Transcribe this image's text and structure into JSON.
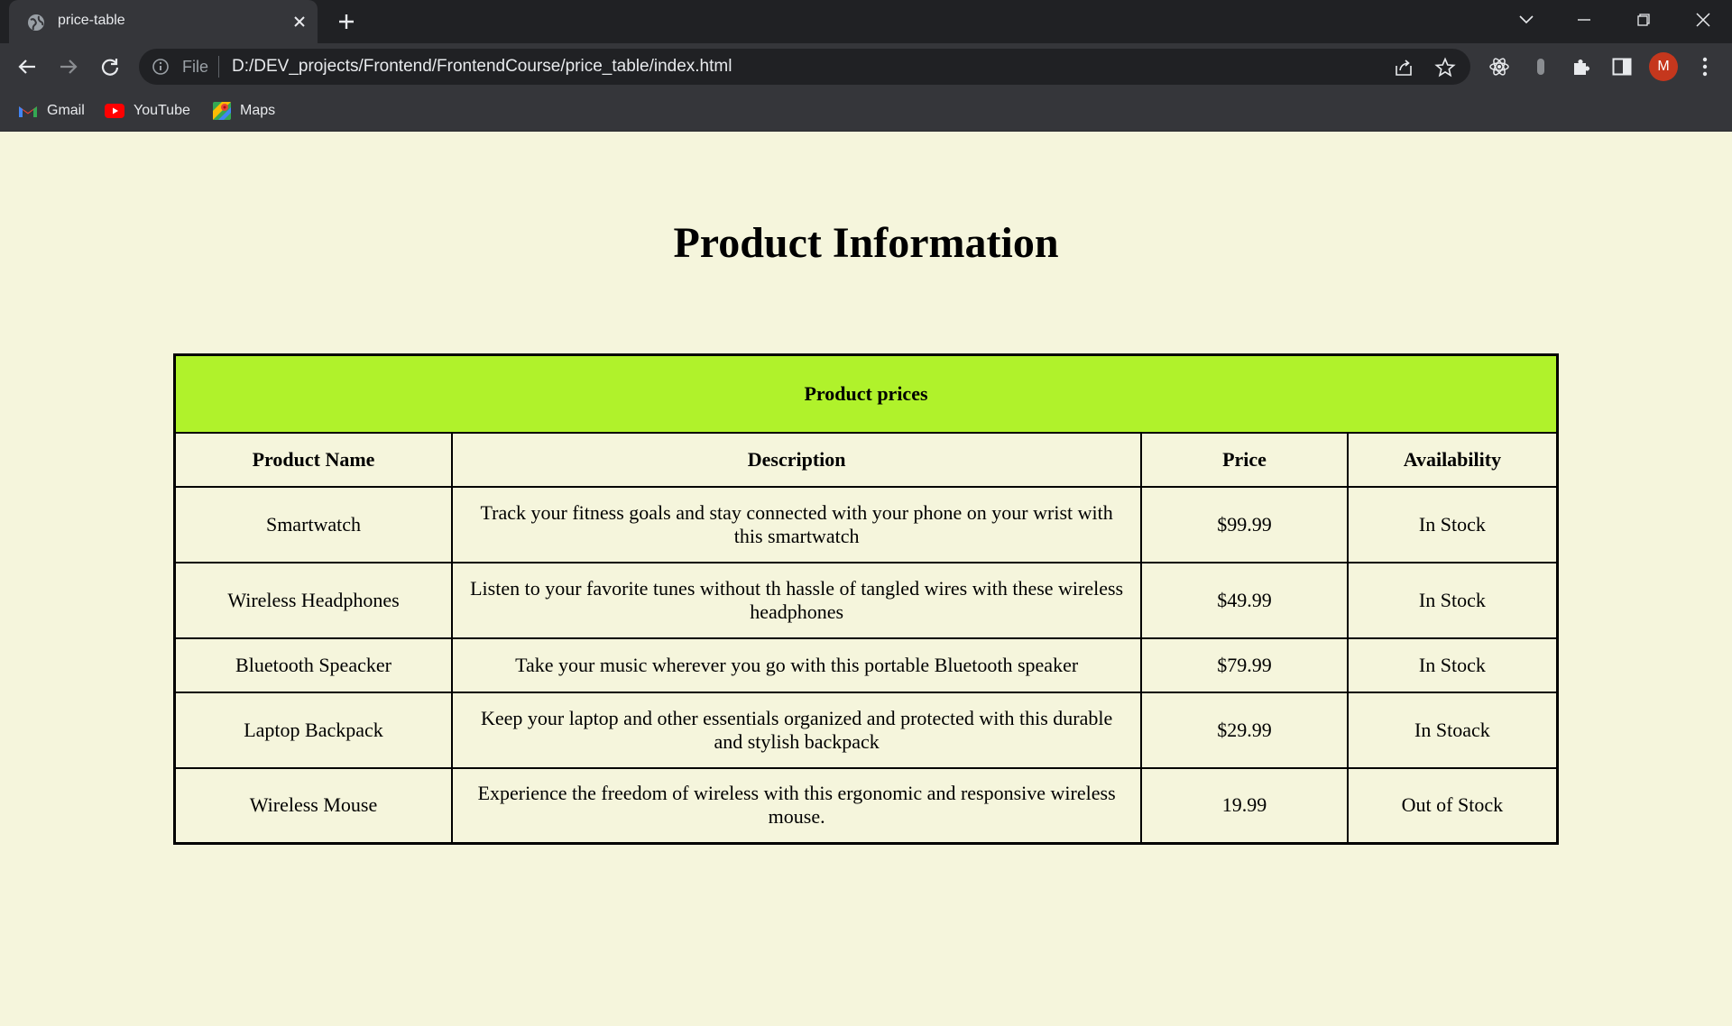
{
  "browser": {
    "tab_title": "price-table",
    "url_scheme": "File",
    "url": "D:/DEV_projects/Frontend/FrontendCourse/price_table/index.html",
    "profile_initial": "M",
    "bookmarks": [
      {
        "label": "Gmail",
        "icon": "gmail-icon"
      },
      {
        "label": "YouTube",
        "icon": "youtube-icon"
      },
      {
        "label": "Maps",
        "icon": "maps-icon"
      }
    ]
  },
  "page": {
    "heading": "Product Information",
    "table": {
      "caption": "Product prices",
      "headers": [
        "Product Name",
        "Description",
        "Price",
        "Availability"
      ],
      "rows": [
        [
          "Smartwatch",
          "Track your fitness goals and stay connected with your phone on your wrist with this smartwatch",
          "$99.99",
          "In Stock"
        ],
        [
          "Wireless Headphones",
          "Listen to your favorite tunes without th hassle of tangled wires with these wireless headphones",
          "$49.99",
          "In Stock"
        ],
        [
          "Bluetooth Speacker",
          "Take your music wherever you go with this portable Bluetooth speaker",
          "$79.99",
          "In Stock"
        ],
        [
          "Laptop Backpack",
          "Keep your laptop and other essentials organized and protected with this durable and stylish backpack",
          "$29.99",
          "In Stoack"
        ],
        [
          "Wireless Mouse",
          "Experience the freedom of wireless with this ergonomic and responsive wireless mouse.",
          "19.99",
          "Out of Stock"
        ]
      ]
    }
  },
  "colors": {
    "page_background": "#f5f5dc",
    "caption_background": "#b0f22b",
    "chrome_dark": "#202124",
    "chrome_toolbar": "#35363a",
    "avatar": "#c5371d"
  }
}
